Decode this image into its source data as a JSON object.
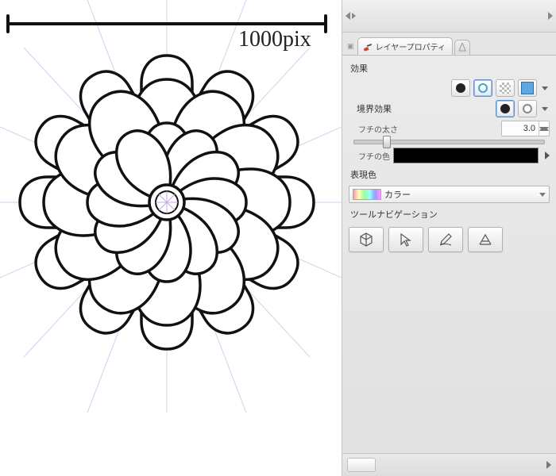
{
  "canvas": {
    "annotation": "1000pix"
  },
  "panel": {
    "tab_label": "レイヤープロパティ",
    "section_effect": "効果",
    "section_border": "境界効果",
    "thickness_label": "フチの太さ",
    "thickness_value": "3.0",
    "border_color_label": "フチの色",
    "expression_label": "表現色",
    "expression_value": "カラー",
    "toolnav_label": "ツールナビゲーション"
  }
}
